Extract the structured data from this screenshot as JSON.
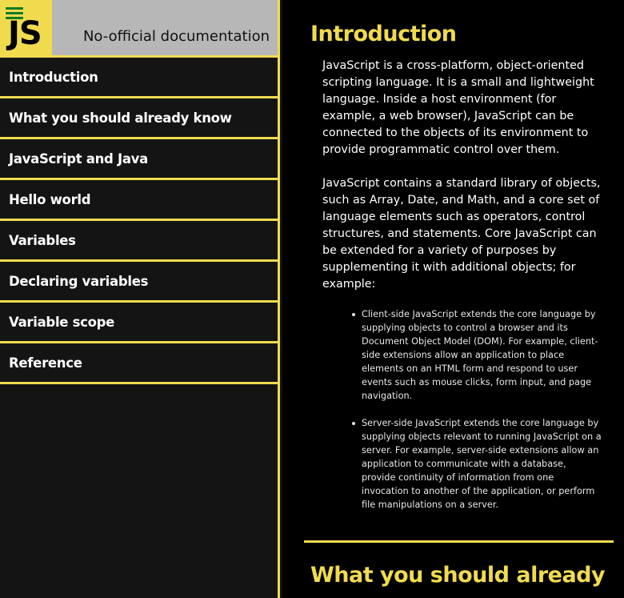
{
  "header": {
    "logo_text": "JS",
    "site_title": "No-official documentation"
  },
  "nav": [
    {
      "label": "Introduction"
    },
    {
      "label": "What you should already know"
    },
    {
      "label": "JavaScript and Java"
    },
    {
      "label": "Hello world"
    },
    {
      "label": "Variables"
    },
    {
      "label": "Declaring variables"
    },
    {
      "label": "Variable scope"
    },
    {
      "label": "Reference"
    }
  ],
  "main": {
    "sections": [
      {
        "title": "Introduction",
        "paragraphs": [
          "JavaScript is a cross-platform, object-oriented scripting language. It is a small and lightweight language. Inside a host environment (for example, a web browser), JavaScript can be connected to the objects of its environment to provide programmatic control over them.",
          "JavaScript contains a standard library of objects, such as Array, Date, and Math, and a core set of language elements such as operators, control structures, and statements. Core JavaScript can be extended for a variety of purposes by supplementing it with additional objects; for example:"
        ],
        "bullets": [
          "Client-side JavaScript extends the core language by supplying objects to control a browser and its Document Object Model (DOM). For example, client-side extensions allow an application to place elements on an HTML form and respond to user events such as mouse clicks, form input, and page navigation.",
          "Server-side JavaScript extends the core language by supplying objects relevant to running JavaScript on a server. For example, server-side extensions allow an application to communicate with a database, provide continuity of information from one invocation to another of the application, or perform file manipulations on a server."
        ]
      },
      {
        "title": "What you should already"
      }
    ]
  },
  "colors": {
    "accent": "#f0db4f",
    "sidebar_bg": "#141414",
    "header_bg": "#b7b7b7",
    "main_bg": "#000000",
    "menu_icon": "#0e7a24"
  },
  "icons": {
    "menu": "hamburger-menu-icon"
  }
}
